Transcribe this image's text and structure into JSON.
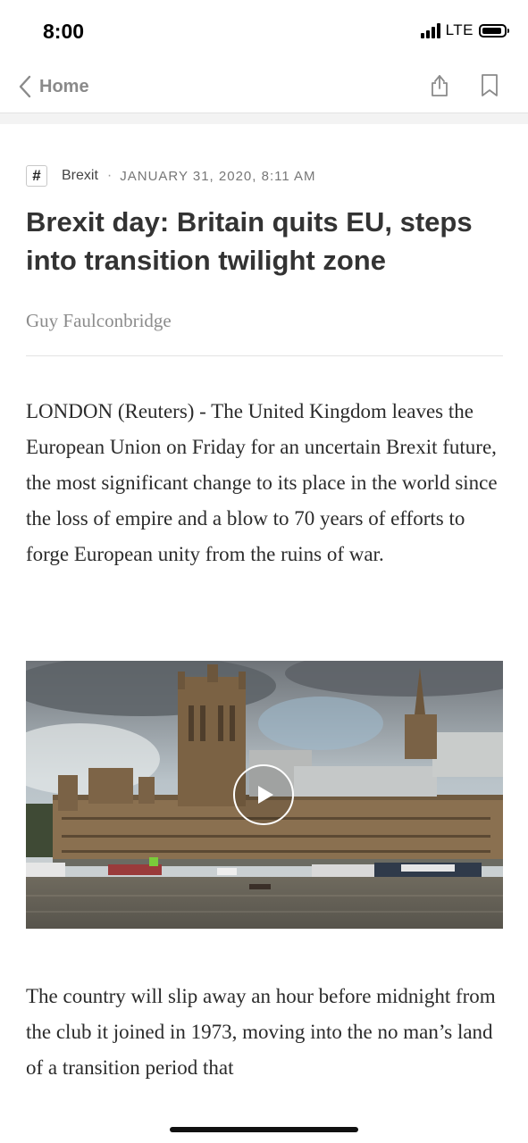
{
  "status_bar": {
    "time": "8:00",
    "network": "LTE"
  },
  "nav": {
    "back_label": "Home",
    "icons": [
      "chevron-left-icon",
      "share-icon",
      "bookmark-icon"
    ]
  },
  "article": {
    "topic_badge": "#",
    "topic": "Brexit",
    "separator": "·",
    "date": "JANUARY 31, 2020, 8:11 AM",
    "headline": "Brexit day: Britain quits EU, steps into transition twilight zone",
    "byline": "Guy Faulconbridge",
    "paragraphs": [
      "LONDON (Reuters) - The United Kingdom leaves the European Union on Friday for an uncertain Brexit future, the most significant change to its place in the world since the loss of empire and a blow to 70 years of efforts to forge European unity from the ruins of war.",
      "The country will slip away an hour before midnight from the club it joined in 1973, moving into the no man’s land of a transition period that"
    ]
  },
  "colors": {
    "headline": "#333333",
    "muted": "#8a8a8a",
    "body": "#2b2b2b"
  }
}
